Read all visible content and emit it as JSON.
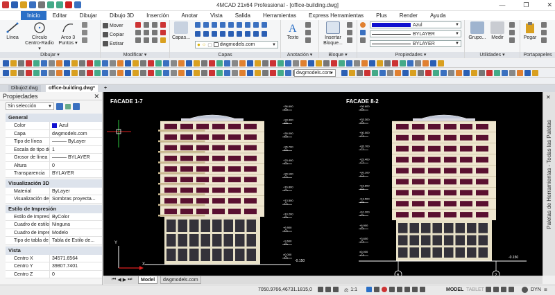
{
  "window": {
    "title": "4MCAD 21x64 Professional - [office-building.dwg]",
    "minimize": "—",
    "maximize": "❐",
    "close": "✕"
  },
  "menu": [
    "Inicio",
    "Editar",
    "Dibujar",
    "Dibujo 3D",
    "Inserción",
    "Anotar",
    "Vista",
    "Salida",
    "Herramientas",
    "Express Herramientas",
    "Plus",
    "Render",
    "Ayuda"
  ],
  "ribbon": {
    "dibujar": {
      "title": "Dibujar ▾",
      "linea": "Línea",
      "circulo": "Círculo",
      "centro_radio": "Centro-Radio ▾",
      "arco": "Arco 3",
      "puntos": "Puntos ▾"
    },
    "modificar": {
      "title": "Modificar ▾",
      "mover": "Mover",
      "copiar": "Copiar",
      "estirar": "Estirar"
    },
    "capas": {
      "title": "Capas",
      "capas_btn": "Capas...",
      "layer_value": "dwgmodels.com"
    },
    "anotacion": {
      "title": "Anotación ▾",
      "texto": "Texto"
    },
    "bloque": {
      "title": "Bloque ▾",
      "insertar": "Insertar",
      "bloque": "Bloque..."
    },
    "propiedades": {
      "title": "Propiedades ▾",
      "color": "Azul",
      "linetype": "BYLAYER",
      "lineweight": "BYLAYER"
    },
    "utilidades": {
      "title": "Utilidades ▾",
      "grupo": "Grupo...",
      "medir": "Medir"
    },
    "portapapeles": {
      "title": "Portapapeles",
      "pegar": "Pegar"
    }
  },
  "toolbar": {
    "textstyle_value": "dwgmodels.com"
  },
  "doc_tabs": [
    "Dibujo2.dwg",
    "office-building.dwg*",
    "+"
  ],
  "properties": {
    "title": "Propiedades",
    "close": "✕",
    "selection": "Sin selección",
    "sections": [
      {
        "name": "General",
        "rows": [
          [
            "Color",
            "Azul"
          ],
          [
            "Capa",
            "dwgmodels.com"
          ],
          [
            "Tipo de línea",
            "——— ByLayer"
          ],
          [
            "Escala de tipo de ...",
            "1"
          ],
          [
            "Grosor de línea",
            "——— BYLAYER"
          ],
          [
            "Altura",
            "0"
          ],
          [
            "Transparencia",
            "BYLAYER"
          ]
        ]
      },
      {
        "name": "Visualización 3D",
        "rows": [
          [
            "Material",
            "ByLayer"
          ],
          [
            "Visualización de s...",
            "Sombras proyecta..."
          ]
        ]
      },
      {
        "name": "Estilo de Impresión",
        "rows": [
          [
            "Estilo de Impresión",
            "ByColor"
          ],
          [
            "Cuadro de estilos ...",
            "Ninguna"
          ],
          [
            "Cuadro de impresi...",
            "Modelo"
          ],
          [
            "Tipo de tabla de t...",
            "Tabla de Estilo de..."
          ]
        ]
      },
      {
        "name": "Vista",
        "rows": [
          [
            "Centro X",
            "34571.6564"
          ],
          [
            "Centro Y",
            "39807.7401"
          ],
          [
            "Centro Z",
            "0"
          ]
        ]
      }
    ]
  },
  "drawing": {
    "facade1_title": "FACADE 1-7",
    "facade2_title": "FACADE 8-2",
    "levels": [
      "+36.600",
      "+33.300",
      "+30.000",
      "+26.700",
      "+23.400",
      "+20.100",
      "+16.800",
      "+13.500",
      "+10.200",
      "+6.900",
      "+3.600",
      "±0.000"
    ],
    "ground_label": "-0.150",
    "ucs_x": "X",
    "ucs_y": "Y",
    "axis1": "6",
    "axis2": "2",
    "colors": {
      "wall": "#efe6cf",
      "window": "#5a1030",
      "balcony": "#c9b88f",
      "base": "#e8e1c8"
    }
  },
  "right_palette": "Paletas de Herramientas - Todas las Paletas",
  "layout_tabs": [
    "Model",
    "dwgmodels.com"
  ],
  "status": {
    "coords": "7050.9766,46731.1815,0",
    "scale": "1:1",
    "model": "MODEL",
    "tablet": "TABLET",
    "dyn": "DYN"
  }
}
